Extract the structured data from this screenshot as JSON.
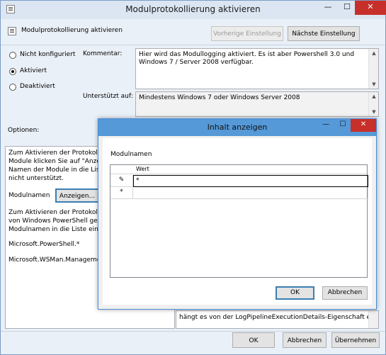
{
  "window": {
    "title": "Modulprotokollierung aktivieren",
    "minimize": "—",
    "maximize": "☐",
    "close": "✕"
  },
  "header": {
    "policy_name": "Modulprotokollierung aktivieren",
    "prev_button": "Vorherige Einstellung",
    "next_button": "Nächste Einstellung"
  },
  "state": {
    "options": [
      {
        "label": "Nicht konfiguriert",
        "selected": false
      },
      {
        "label": "Aktiviert",
        "selected": true
      },
      {
        "label": "Deaktiviert",
        "selected": false
      }
    ]
  },
  "comment": {
    "label": "Kommentar:",
    "text": "Hier wird das Modullogging aktiviert. Es ist aber Powershell 3.0 und Windows 7 / Server 2008 verfügbar."
  },
  "supported": {
    "label": "Unterstützt auf:",
    "text": "Mindestens Windows 7 oder Windows Server 2008"
  },
  "options_section": {
    "label": "Optionen:",
    "lines1": [
      "Zum Aktivieren der Protokollier",
      "Module klicken Sie auf \"Anzeig",
      "Namen der Module in die Liste",
      "nicht unterstützt."
    ],
    "modulnamen_label": "Modulnamen",
    "show_button": "Anzeigen...",
    "lines2": [
      "Zum Aktivieren der Protokollier",
      "von Windows PowerShell geben",
      "Modulnamen in die Liste ein:"
    ],
    "line3": "Microsoft.PowerShell.*",
    "line4": "Microsoft.WSMan.Managemen"
  },
  "help_section": {
    "last_line": "hängt es von der LogPipelineExecutionDetails-Eigenschaft eines"
  },
  "footer": {
    "ok": "OK",
    "cancel": "Abbrechen",
    "apply": "Übernehmen"
  },
  "dialog": {
    "title": "Inhalt anzeigen",
    "minimize": "—",
    "maximize": "☐",
    "close": "✕",
    "group_label": "Modulnamen",
    "column_header": "Wert",
    "rows": [
      {
        "marker": "✎",
        "value": "*"
      },
      {
        "marker": "*",
        "value": ""
      }
    ],
    "ok": "OK",
    "cancel": "Abbrechen"
  },
  "colors": {
    "accent": "#5599d8",
    "close": "#c7302a",
    "background": "#eaf0f7"
  }
}
